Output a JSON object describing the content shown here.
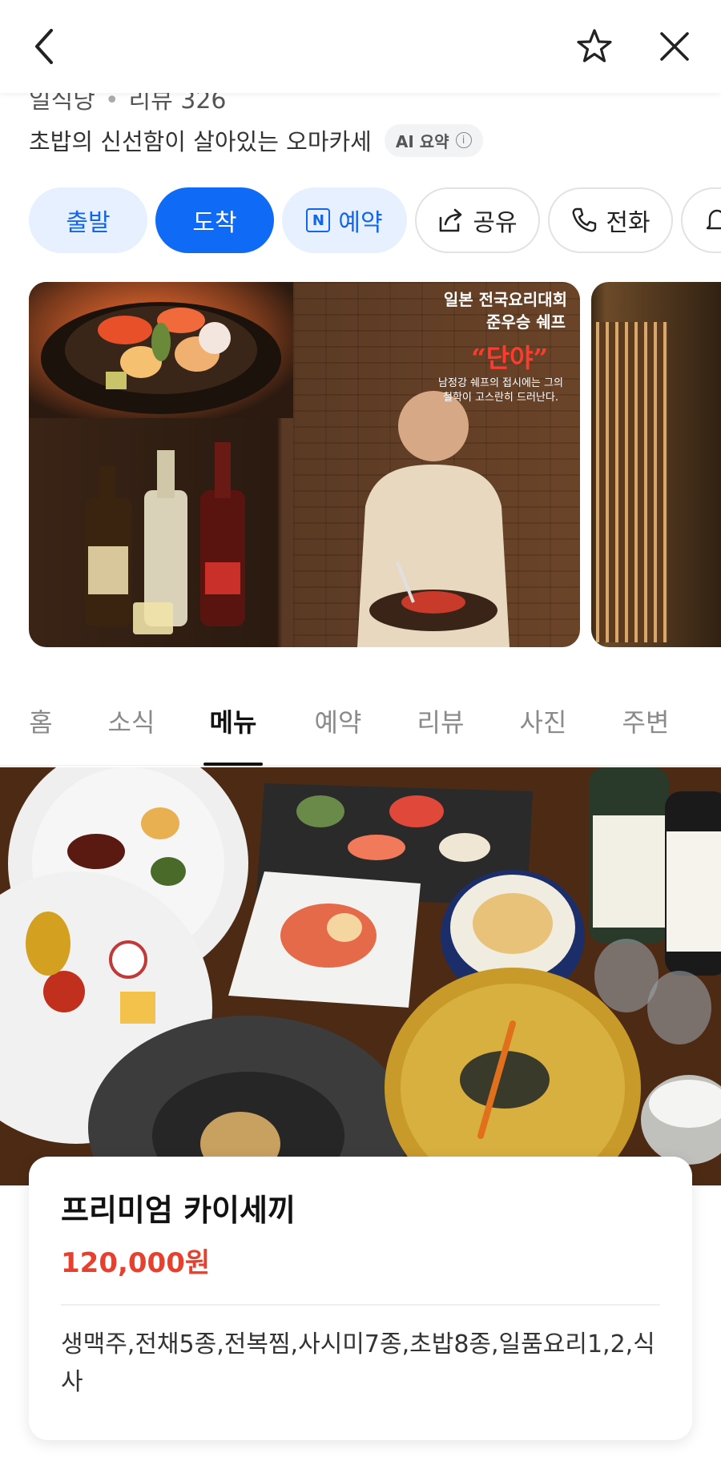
{
  "header": {
    "back_icon": "chevron-left-icon",
    "favorite_icon": "star-icon",
    "close_icon": "close-icon"
  },
  "summary": {
    "category": "일식당",
    "review_label": "리뷰 326",
    "tagline": "초밥의 신선함이 살아있는 오마카세",
    "ai_chip_label": "AI 요약",
    "ai_info_icon": "info-icon"
  },
  "actions": {
    "depart": "출발",
    "arrive": "도착",
    "reserve": "예약",
    "share": "공유",
    "call": "전화"
  },
  "photo_overlay": {
    "line1": "일본 전국요리대회",
    "line2": "준우승 쉐프",
    "name": "“단야”",
    "caption": "남정강 쉐프의 접시에는 그의 철학이 고스란히 드러난다."
  },
  "tabs": [
    {
      "label": "홈"
    },
    {
      "label": "소식"
    },
    {
      "label": "메뉴",
      "active": true
    },
    {
      "label": "예약"
    },
    {
      "label": "리뷰"
    },
    {
      "label": "사진"
    },
    {
      "label": "주변"
    }
  ],
  "menu_item": {
    "name": "프리미엄 카이세끼",
    "price": "120,000원",
    "description": "생맥주,전채5종,전복찜,사시미7종,초밥8종,일품요리1,2,식사"
  },
  "colors": {
    "accent_blue": "#0f6bf5",
    "light_blue": "#e6f0fe",
    "price_red": "#e8402e"
  }
}
